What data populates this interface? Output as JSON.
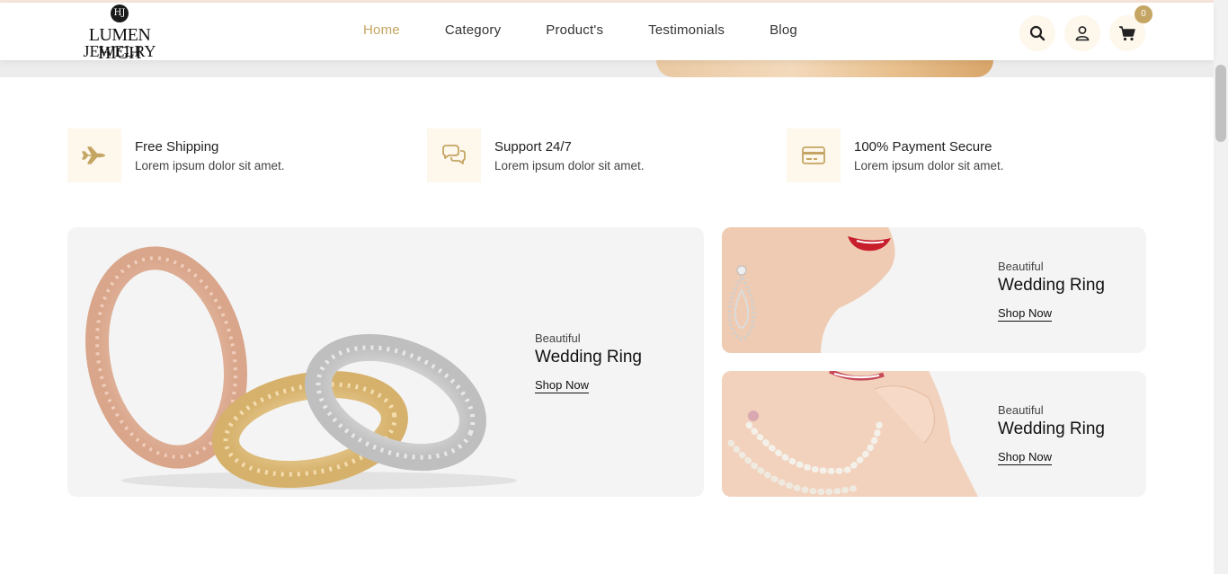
{
  "logo": {
    "monogram": "HJ",
    "line1": "LUMEN HIGH",
    "line2": "JEWELRY"
  },
  "nav": {
    "home": "Home",
    "category": "Category",
    "products": "Product's",
    "testimonials": "Testimonials",
    "blog": "Blog"
  },
  "header": {
    "cart_count": "0"
  },
  "features": [
    {
      "title": "Free Shipping",
      "desc": "Lorem ipsum dolor sit amet.",
      "icon": "airplane-icon"
    },
    {
      "title": "Support 24/7",
      "desc": "Lorem ipsum dolor sit amet.",
      "icon": "chat-icon"
    },
    {
      "title": "100% Payment Secure",
      "desc": "Lorem ipsum dolor sit amet.",
      "icon": "credit-card-icon"
    }
  ],
  "banners": [
    {
      "sub": "Beautiful",
      "title": "Wedding Ring",
      "link": "Shop Now"
    },
    {
      "sub": "Beautiful",
      "title": "Wedding Ring",
      "link": "Shop Now"
    },
    {
      "sub": "Beautiful",
      "title": "Wedding Ring",
      "link": "Shop Now"
    }
  ],
  "colors": {
    "accent": "#c5a563",
    "icon_bg": "#fdf7ec",
    "banner_bg": "#f4f4f4"
  }
}
